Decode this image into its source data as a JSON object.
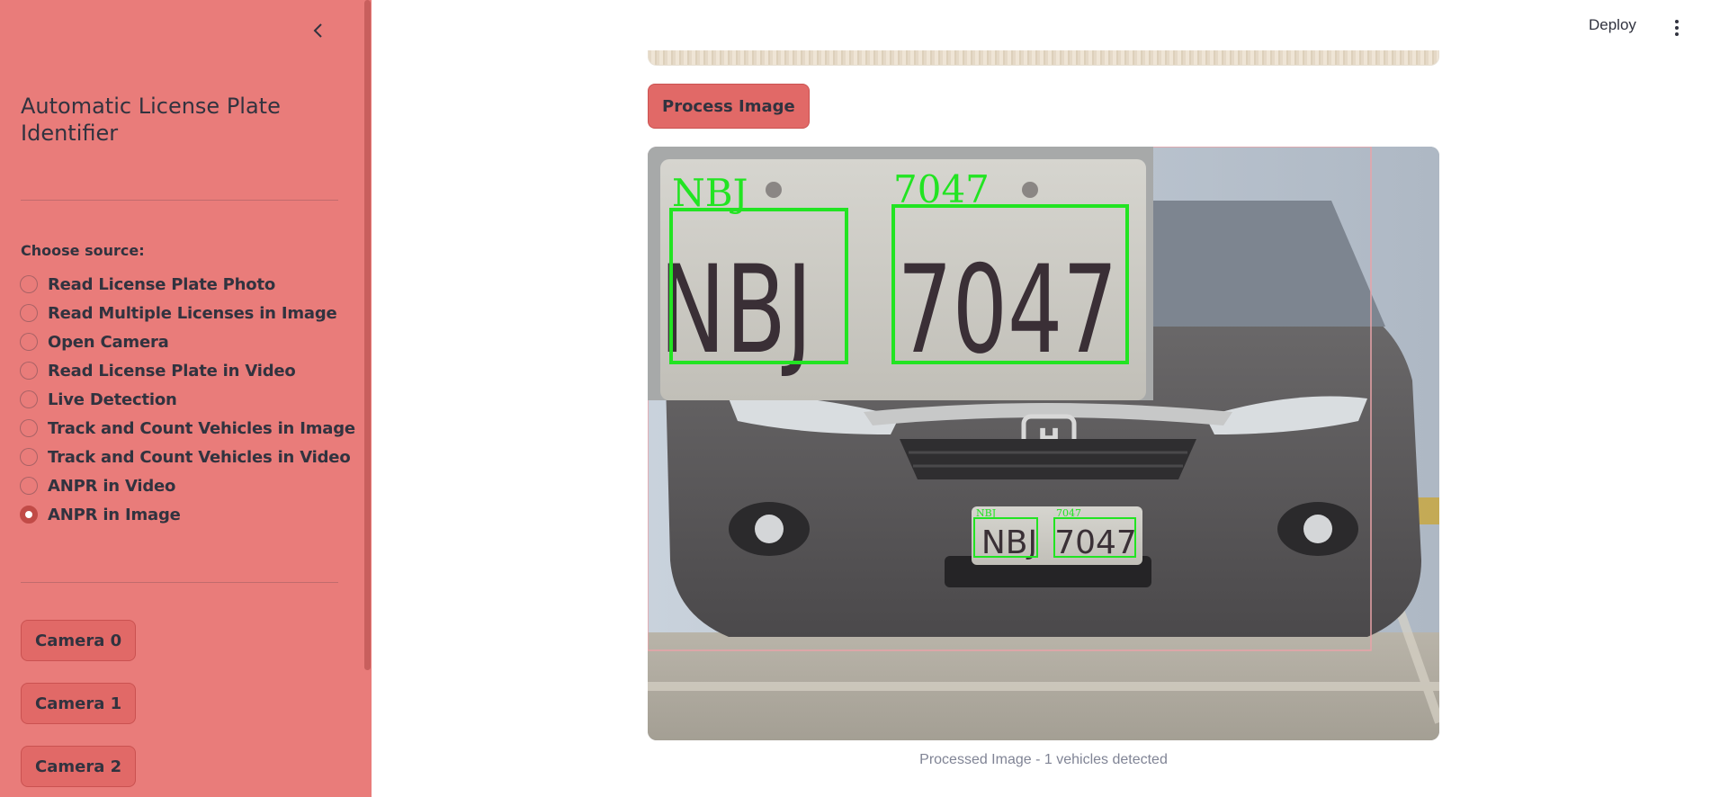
{
  "app": {
    "title": "Automatic License Plate Identifier"
  },
  "header": {
    "deploy_label": "Deploy"
  },
  "sidebar": {
    "source_label": "Choose source:",
    "options": [
      "Read License Plate Photo",
      "Read Multiple Licenses in Image",
      "Open Camera",
      "Read License Plate in Video",
      "Live Detection",
      "Track and Count Vehicles in Image",
      "Track and Count Vehicles in Video",
      "ANPR in Video",
      "ANPR in Image"
    ],
    "selected_option": "ANPR in Image",
    "camera_buttons": [
      "Camera 0",
      "Camera 1",
      "Camera 2"
    ]
  },
  "main": {
    "process_button_label": "Process Image",
    "plate_text_left": "NBJ",
    "plate_text_right": "7047",
    "caption": "Processed Image - 1 vehicles detected"
  },
  "colors": {
    "sidebar_bg": "#e97c7a",
    "button_bg": "#e16967",
    "detection_box": "#22e422",
    "radio_selected": "#c14b47"
  }
}
